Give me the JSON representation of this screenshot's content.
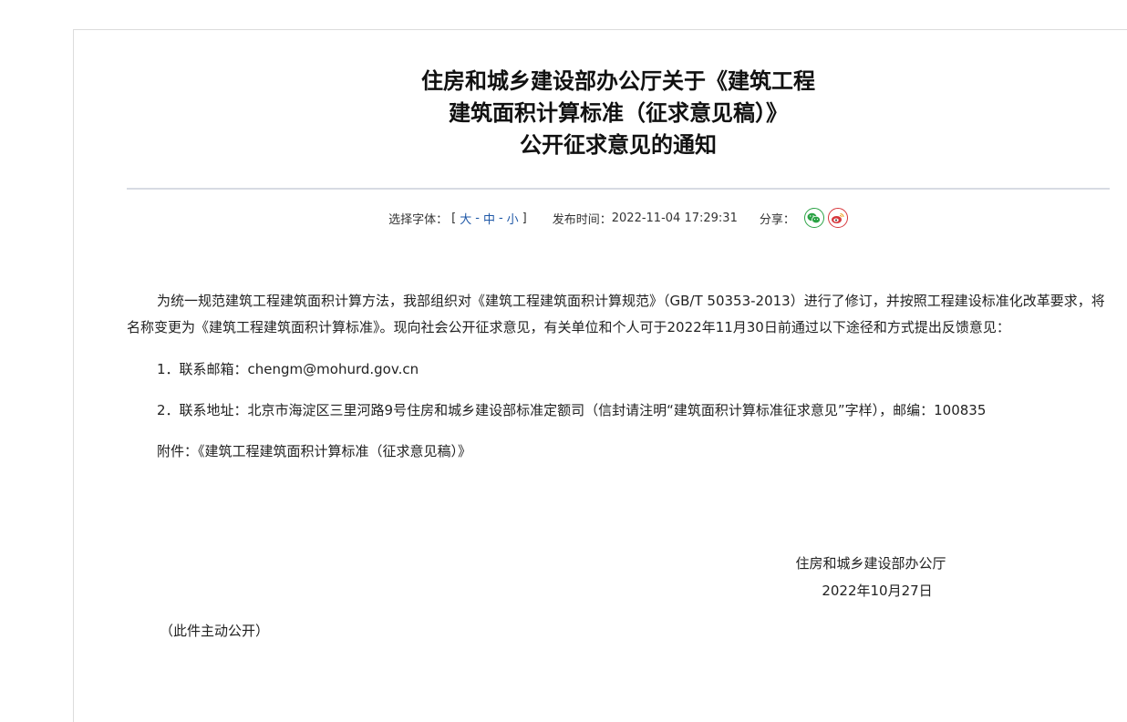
{
  "article": {
    "title_lines": [
      "住房和城乡建设部办公厅关于《建筑工程",
      "建筑面积计算标准（征求意见稿）》",
      "公开征求意见的通知"
    ]
  },
  "meta": {
    "font_size_label": "选择字体：",
    "bracket_open": "[",
    "font_sizes": [
      "大",
      "中",
      "小"
    ],
    "font_sep": "-",
    "bracket_close": "]",
    "publish_time_label": "发布时间：",
    "publish_time": "2022-11-04 17:29:31",
    "share_label": "分享："
  },
  "share": {
    "wechat_color": "#2ba245",
    "weibo_color": "#d7363b"
  },
  "content": {
    "paragraph": "为统一规范建筑工程建筑面积计算方法，我部组织对《建筑工程建筑面积计算规范》（GB/T 50353-2013）进行了修订，并按照工程建设标准化改革要求，将名称变更为《建筑工程建筑面积计算标准》。现向社会公开征求意见，有关单位和个人可于2022年11月30日前通过以下途径和方式提出反馈意见：",
    "items": [
      "1．联系邮箱：chengm@mohurd.gov.cn",
      "2．联系地址：北京市海淀区三里河路9号住房和城乡建设部标准定额司（信封请注明“建筑面积计算标准征求意见”字样），邮编：100835",
      "附件：《建筑工程建筑面积计算标准（征求意见稿）》"
    ]
  },
  "signature": {
    "issuer": "住房和城乡建设部办公厅",
    "date": "2022年10月27日"
  },
  "footer": {
    "disclosure": "（此件主动公开）"
  }
}
